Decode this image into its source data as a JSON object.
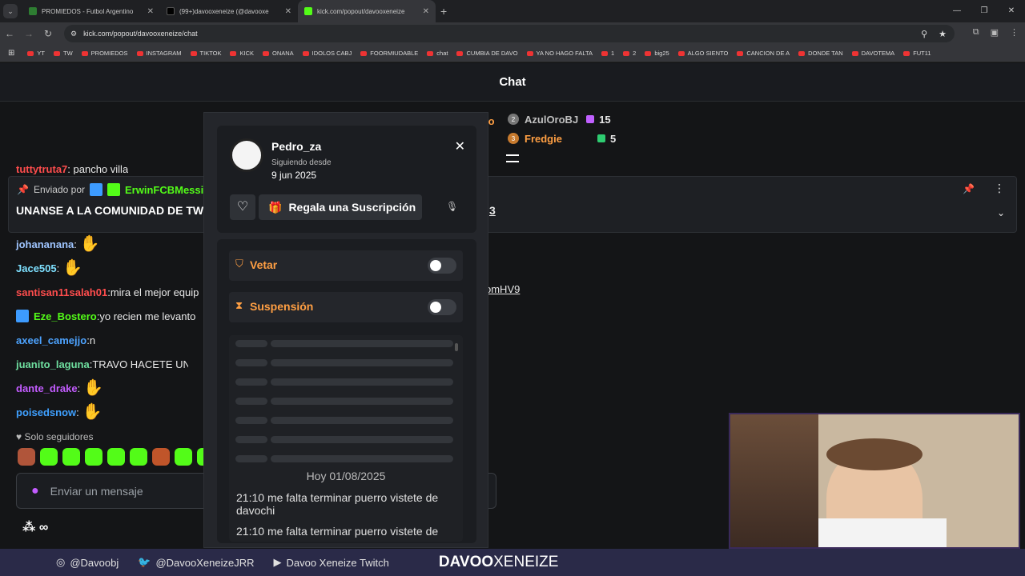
{
  "browser": {
    "tabs": [
      {
        "label": "PROMIEDOS - Futbol Argentino",
        "color": "#2e7d32"
      },
      {
        "label": "(99+)davooxeneize (@davooxe",
        "color": "#000000"
      },
      {
        "label": "kick.com/popout/davooxeneize",
        "color": "#53fc18"
      }
    ],
    "url": "kick.com/popout/davooxeneize/chat",
    "bookmarks": [
      "YT",
      "TW",
      "PROMIEDOS",
      "INSTAGRAM",
      "TIKTOK",
      "KICK",
      "ONANA",
      "IDOLOS CABJ",
      "FOORMIUDABLE",
      "chat",
      "CUMBIA DE DAVO",
      "YA NO HAGO FALTA",
      "1",
      "2",
      "big25",
      "ALGO SIENTO",
      "CANCION DE A",
      "DONDE TAN",
      "DAVOTEMA",
      "FUT11"
    ]
  },
  "header": {
    "title": "Chat"
  },
  "leaderboard": [
    {
      "rank": "2",
      "name": "AzulOroBJ",
      "count": "15",
      "color": "#c0c0c0",
      "gift": "#c060ff"
    },
    {
      "rank": "3",
      "name": "Fredgie",
      "count": "5",
      "color": "#ff9f43",
      "gift": "#2ecc71"
    }
  ],
  "leaderboard_partial": "io",
  "pinned": {
    "sent_by": "Enviado por",
    "user": "ErwinFCBMessii",
    "text": "UNANSE A LA COMUNIDAD DE TW",
    "link_tail": "3",
    "above_name": "tuttytruta7",
    "above_text": "pancho villa"
  },
  "chat": [
    {
      "user": "johananana",
      "text": "",
      "color": "#9fc5ff",
      "emote": true
    },
    {
      "user": "Jace505",
      "text": "",
      "color": "#7ee0ff",
      "emote": true
    },
    {
      "user": "santisan11salah01",
      "text": "mira el mejor equip",
      "color": "#ff4d4d",
      "emote": false,
      "tail": "omHV9"
    },
    {
      "user": "Eze_Bostero",
      "text": "yo recien me levanto",
      "color": "#53fc18",
      "emote": false
    },
    {
      "user": "axeel_camejjo",
      "text": "n",
      "color": "#4da3ff",
      "emote": false
    },
    {
      "user": "juanito_laguna",
      "text": "TRAVO HACETE UNA",
      "color": "#6fe0a0",
      "emote": false
    },
    {
      "user": "dante_drake",
      "text": "",
      "color": "#c35cff",
      "emote": true
    },
    {
      "user": "poisedsnow",
      "text": "",
      "color": "#3fa0ff",
      "emote": true
    }
  ],
  "followers_only": "Solo seguidores",
  "input_placeholder": "Enviar un mensaje",
  "infinity": "∞",
  "profile": {
    "name": "Pedro_za",
    "since_label": "Siguiendo desde",
    "since_date": "9 jun 2025",
    "gift_button": "Regala una Suscripción",
    "ban_label": "Vetar",
    "timeout_label": "Suspensión",
    "date_header": "Hoy 01/08/2025",
    "messages": [
      {
        "time": "21:10",
        "text": "me falta terminar puerro vistete de davochi"
      },
      {
        "time": "21:10",
        "text": "me falta terminar puerro vistete de"
      }
    ]
  },
  "socials": [
    {
      "icon": "instagram-icon",
      "label": "@Davoobj"
    },
    {
      "icon": "twitter-icon",
      "label": "@DavooXeneizeJRR"
    },
    {
      "icon": "youtube-icon",
      "label": "Davoo Xeneize Twitch"
    }
  ],
  "brand": {
    "part1": "DAVOO",
    "part2": "XENEIZE"
  }
}
